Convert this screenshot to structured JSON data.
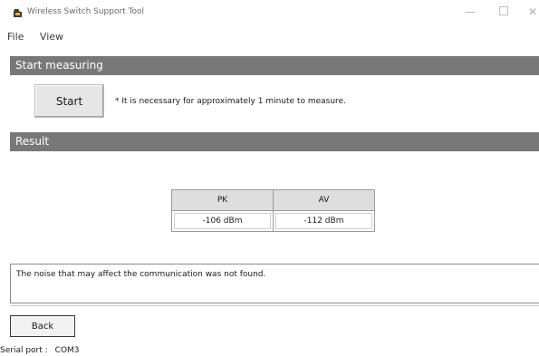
{
  "window": {
    "title": "Wireless Switch Support Tool",
    "minimize": "—",
    "close": "✕"
  },
  "menu": [
    "File",
    "View"
  ],
  "measure": {
    "header": "Start measuring",
    "start_label": "Start",
    "note": "* It is necessary for approximately 1 minute to measure."
  },
  "result": {
    "header": "Result",
    "columns": [
      "PK",
      "AV"
    ],
    "values": [
      "-106 dBm",
      "-112 dBm"
    ],
    "message": "The noise that may affect the communication was not found."
  },
  "footer": {
    "back_label": "Back",
    "serial_label": "Serial port :",
    "serial_value": "COM3"
  }
}
